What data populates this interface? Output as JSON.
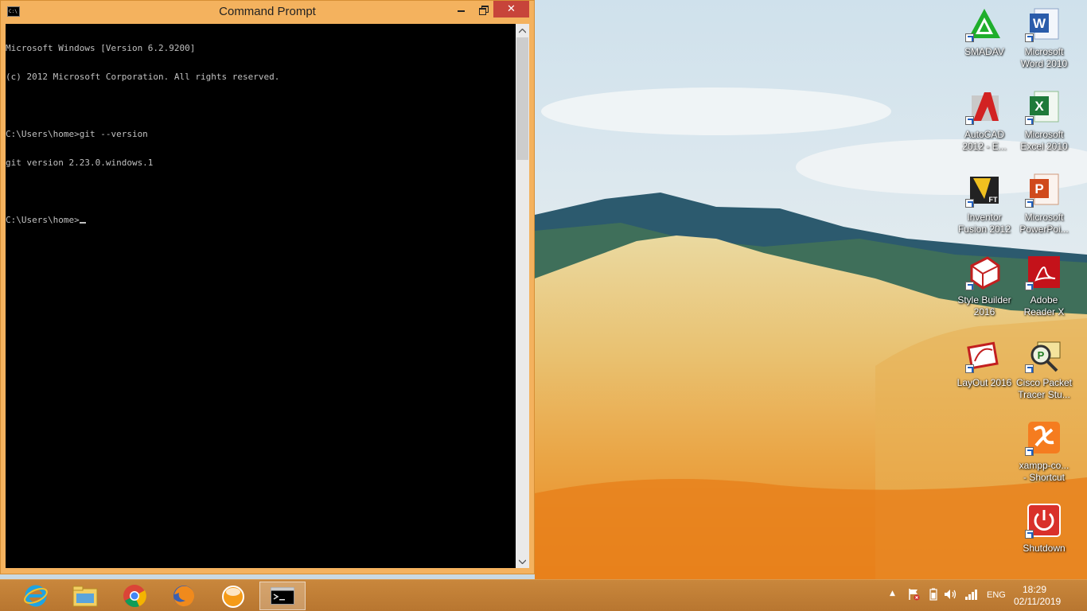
{
  "window": {
    "title": "Command Prompt",
    "close_glyph": "✕",
    "console_lines": [
      "Microsoft Windows [Version 6.2.9200]",
      "(c) 2012 Microsoft Corporation. All rights reserved.",
      "",
      "C:\\Users\\home>git --version",
      "git version 2.23.0.windows.1",
      "",
      "C:\\Users\\home>"
    ],
    "scroll_up_glyph": "▲",
    "scroll_down_glyph": "▼"
  },
  "desktop_icons": [
    {
      "label_line1": "SMADAV",
      "label_line2": "",
      "icon": "smadav-icon"
    },
    {
      "label_line1": "Microsoft",
      "label_line2": "Word 2010",
      "icon": "word-icon"
    },
    {
      "label_line1": "AutoCAD",
      "label_line2": "2012 - E...",
      "icon": "autocad-icon"
    },
    {
      "label_line1": "Microsoft",
      "label_line2": "Excel 2010",
      "icon": "excel-icon"
    },
    {
      "label_line1": "Inventor",
      "label_line2": "Fusion 2012",
      "icon": "inventor-fusion-icon"
    },
    {
      "label_line1": "Microsoft",
      "label_line2": "PowerPoi...",
      "icon": "powerpoint-icon"
    },
    {
      "label_line1": "Style Builder",
      "label_line2": "2016",
      "icon": "style-builder-icon"
    },
    {
      "label_line1": "Adobe",
      "label_line2": "Reader X",
      "icon": "adobe-reader-icon"
    },
    {
      "label_line1": "LayOut 2016",
      "label_line2": "",
      "icon": "layout-icon"
    },
    {
      "label_line1": "Cisco Packet",
      "label_line2": "Tracer Stu...",
      "icon": "packet-tracer-icon"
    },
    {
      "label_line1": "xampp-co...",
      "label_line2": "- Shortcut",
      "icon": "xampp-icon"
    },
    {
      "label_line1": "Shutdown",
      "label_line2": "",
      "icon": "shutdown-icon"
    }
  ],
  "taskbar": {
    "pinned": [
      "internet-explorer-icon",
      "file-explorer-icon",
      "chrome-icon",
      "firefox-icon",
      "media-player-icon",
      "command-prompt-icon"
    ],
    "tray": {
      "show_hidden_glyph": "▲",
      "language": "ENG",
      "time": "18:29",
      "date": "02/11/2019"
    }
  },
  "colors": {
    "window_frame": "#f4b25e",
    "close_button": "#c7443a",
    "console_background": "#000000",
    "console_text": "#c0c0c0",
    "taskbar": "#c18034"
  }
}
